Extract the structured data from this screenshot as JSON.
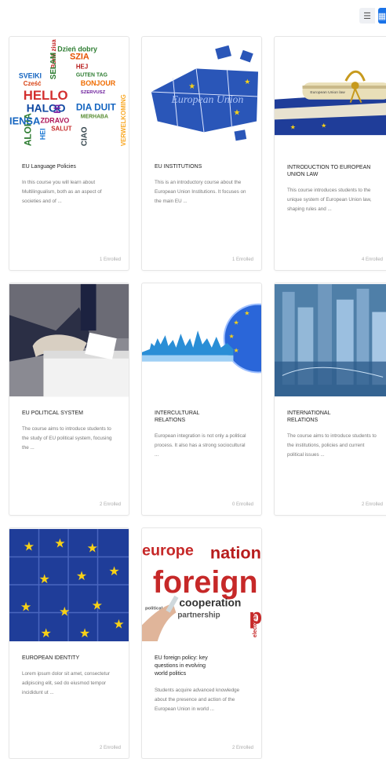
{
  "view_toggle": {
    "list_icon": "list-icon",
    "grid_icon": "grid-icon"
  },
  "courses": [
    {
      "title": "EU Language Policies",
      "desc": "In this course you will learn about Multilingualism, both as an aspect of societies and of ...",
      "enrolled": "1 Enrolled",
      "image": "language-wordcloud"
    },
    {
      "title": "EU INSTITUTIONS",
      "desc": "This is an introductory course about the European Union Institutions. It focuses on the main EU ...",
      "enrolled": "1 Enrolled",
      "image": "european-union-puzzle",
      "image_text": "European Union"
    },
    {
      "title": "INTRODUCTION TO EUROPEAN UNION LAW",
      "desc": "This course introduces students to the unique system of European Union law, shaping rules and ...",
      "enrolled": "4 Enrolled",
      "image": "eu-law-scroll",
      "image_text": "European Union law"
    },
    {
      "title": "EU POLITICAL SYSTEM",
      "desc": "The course aims to introduce students to the study of EU political system, focusing the ...",
      "enrolled": "2 Enrolled",
      "image": "ballot-box"
    },
    {
      "title": "INTERCULTURAL RELATIONS",
      "desc": "European integration is not only a political process. It also has a strong sociocultural ...",
      "enrolled": "0 Enrolled",
      "image": "skyline-eu-globe"
    },
    {
      "title": "INTERNATIONAL RELATIONS",
      "desc": "The course aims to introduce students to the institutions, policies and current political issues ...",
      "enrolled": "2 Enrolled",
      "image": "city-world-map"
    },
    {
      "title": "EUROPEAN IDENTITY",
      "desc": "Lorem ipsum dolor sit amet, consectetur adipiscing elit, sed do eiusmod tempor incididunt ut ...",
      "enrolled": "2 Enrolled",
      "image": "eu-flag-puzzle"
    },
    {
      "title": "EU foreign policy: key questions in evolving world politics",
      "desc": "Students acquire advanced knowledge about the presence and action of the European Union in world ...",
      "enrolled": "2 Enrolled",
      "image": "foreign-policy-wordcloud"
    }
  ],
  "wordcloud_1": [
    "Dzień dobry",
    "Bună ziua",
    "SZIA",
    "SVEIKI",
    "SELAM",
    "HEJ",
    "Cześć",
    "GUTEN TAG",
    "HELLO",
    "BONJOUR",
    "SZERVUSZ",
    "HALOO",
    "Hi",
    "DIA DUIT",
    "ZDRAVO",
    "MERHABA",
    "SALUT",
    "ALOHA",
    "HEI",
    "VERWELKOMING",
    "CIAO",
    "IENSA"
  ],
  "wordcloud_2": [
    "europe",
    "nation",
    "foreign",
    "cooperation",
    "partnership",
    "political",
    "electoral",
    "po"
  ],
  "colors": {
    "accent": "#1a73e8",
    "eu_blue": "#1f3d99",
    "eu_gold": "#f7d117"
  }
}
